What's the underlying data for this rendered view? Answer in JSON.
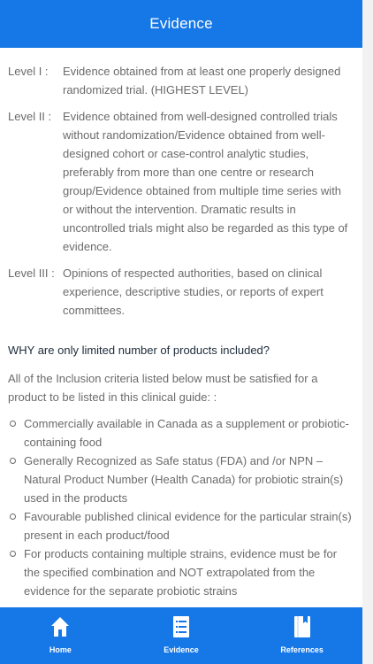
{
  "header": {
    "title": "Evidence"
  },
  "levels": [
    {
      "key": "Level I :",
      "text": "Evidence obtained from at least one properly designed randomized trial. (HIGHEST LEVEL)"
    },
    {
      "key": "Level II :",
      "text": "Evidence obtained from well-designed controlled trials without randomization/Evidence obtained from well-designed cohort or case-control analytic studies, preferably from more than one centre or research group/Evidence obtained from multiple time series with or without the intervention. Dramatic results in uncontrolled trials might also be regarded as this type of evidence."
    },
    {
      "key": "Level III :",
      "text": "Opinions of respected authorities, based on clinical experience, descriptive studies, or reports of expert committees."
    }
  ],
  "why": {
    "title": "WHY are only limited number of products included?",
    "intro": "All of the Inclusion criteria listed below must be satisfied for a product to be listed in this clinical guide: :",
    "criteria": [
      "Commercially available in Canada as a supplement or probiotic-containing food",
      "Generally Recognized as Safe status (FDA) and /or NPN – Natural Product Number (Health Canada) for probiotic strain(s) used in the products",
      "Favourable published clinical evidence for the particular strain(s) present in each product/food",
      "For products containing multiple strains, evidence must be for the specified combination and NOT extrapolated from the evidence for the separate probiotic strains"
    ]
  },
  "tabs": [
    {
      "label": "Home",
      "icon": "home-icon"
    },
    {
      "label": "Evidence",
      "icon": "list-icon"
    },
    {
      "label": "References",
      "icon": "book-icon"
    }
  ],
  "colors": {
    "accent": "#1677e6",
    "text": "#6b6b6b",
    "title": "#1b2a3a"
  }
}
